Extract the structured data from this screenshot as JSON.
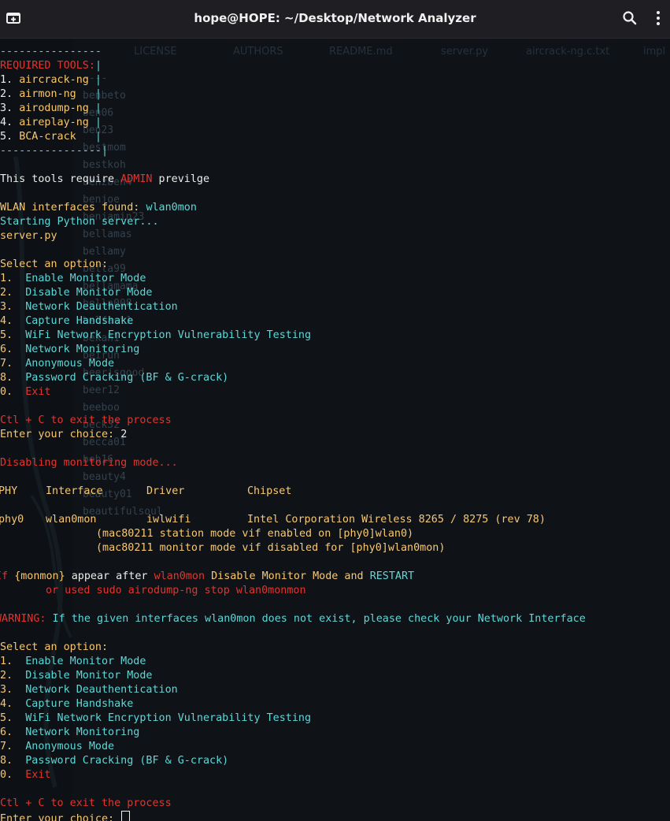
{
  "window": {
    "title": "hope@HOPE: ~/Desktop/Network Analyzer"
  },
  "background_editor": {
    "tabs": [
      "LICENSE",
      "AUTHORS",
      "README.md",
      "server.py",
      "aircrack-ng.c.txt",
      "impl"
    ],
    "wordlist": [
      "----",
      "benbeto",
      "ben06",
      "ben23",
      "bestmom",
      "bestkoh",
      "benzben4",
      "benjoe",
      "benjamin23",
      "bellamas",
      "bellamy",
      "bella99",
      "bellamama",
      "bella008",
      "belfast1",
      "bekah1",
      "beirun",
      "beerisgood",
      "beer12",
      "beeboo",
      "beck32",
      "becca01",
      "beb16",
      "beauty4",
      "beauty01",
      "beautifulsoul"
    ]
  },
  "terminal": {
    "tools_border_top": "----------------",
    "tools_header": "REQUIRED TOOLS:",
    "tools_pipe": "|",
    "tools": [
      {
        "num": "1. ",
        "name": "aircrack-ng",
        "tail": " |"
      },
      {
        "num": "2. ",
        "name": "airmon-ng",
        "tail": "   |"
      },
      {
        "num": "3. ",
        "name": "airodump-ng",
        "tail": " |"
      },
      {
        "num": "4. ",
        "name": "aireplay-ng",
        "tail": " |"
      },
      {
        "num": "5. ",
        "name": "BCA-crack",
        "tail": "   |"
      }
    ],
    "tools_border_bottom": "----------------|",
    "admin_pre": "This tools require ",
    "admin_word": "ADMIN",
    "admin_post": " previlge",
    "wlan_label": "WLAN interfaces found: ",
    "wlan_value": "wlan0mon",
    "starting_server": "Starting Python server...",
    "server_file": "server.py",
    "menu_title": "Select an option:",
    "menu_items": [
      {
        "num": "1.",
        "label": "Enable Monitor Mode"
      },
      {
        "num": "2.",
        "label": "Disable Monitor Mode"
      },
      {
        "num": "3.",
        "label": "Network Deauthentication"
      },
      {
        "num": "4.",
        "label": "Capture Handshake"
      },
      {
        "num": "5.",
        "label": "WiFi Network Encryption Vulnerability Testing"
      },
      {
        "num": "6.",
        "label": "Network Monitoring"
      },
      {
        "num": "7.",
        "label": "Anonymous Mode"
      },
      {
        "num": "8.",
        "label": "Password Cracking (BF & G-crack)"
      }
    ],
    "exit_num": "0.",
    "exit_label": "Exit",
    "ctrl_c": "Ctl + C to exit the process",
    "prompt": "Enter your choice: ",
    "choice1": "2",
    "disabling": "Disabling monitoring mode...",
    "table_header": {
      "phy": "PHY",
      "iface": "Interface",
      "driver": "Driver",
      "chipset": "Chipset"
    },
    "table_row": {
      "phy": "phy0",
      "iface": "wlan0mon",
      "driver": "iwlwifi",
      "chipset": "Intel Corporation Wireless 8265 / 8275 (rev 78)"
    },
    "mac_line1": "(mac80211 station mode vif enabled on [phy0]wlan0)",
    "mac_line2": "(mac80211 monitor mode vif disabled for [phy0]wlan0mon)",
    "if_pre": "If ",
    "if_monmon": "{monmon}",
    "if_mid": " appear after ",
    "if_iface": "wlan0mon",
    "if_action": " Disable Monitor Mode",
    "if_and": " and ",
    "if_restart": "RESTART",
    "or_used": "or used sudo airodump-ng stop wlan0monmon",
    "warning_label": "WARNING:",
    "warning_text": " If the given interfaces wlan0mon does not exist, please check your Network Interface"
  },
  "colors": {
    "cyan": "#5fd7d7",
    "yellow": "#f7c873",
    "red": "#e0352f",
    "white": "#ececec"
  }
}
